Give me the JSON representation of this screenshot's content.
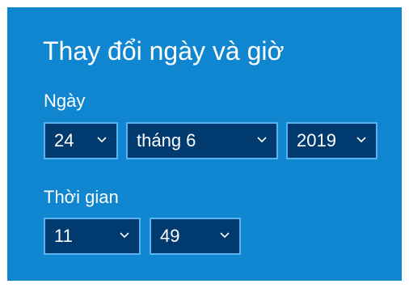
{
  "dialog": {
    "title": "Thay đổi ngày và giờ"
  },
  "date": {
    "label": "Ngày",
    "day": "24",
    "month": "tháng 6",
    "year": "2019"
  },
  "time": {
    "label": "Thời gian",
    "hour": "11",
    "minute": "49"
  },
  "colors": {
    "panel_bg": "#0f86cf",
    "select_bg": "#003a6e",
    "select_border": "#57b2ef",
    "text": "#ffffff"
  },
  "icons": {
    "dropdown": "chevron-down-icon"
  }
}
